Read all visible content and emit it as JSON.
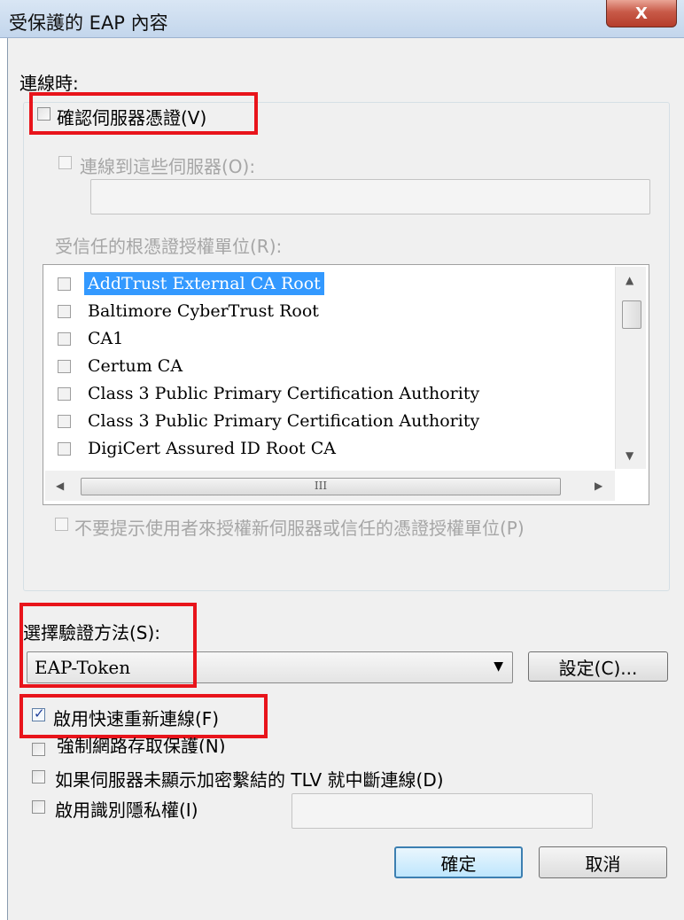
{
  "window": {
    "title": "受保護的 EAP 內容",
    "close_glyph": "X"
  },
  "connect": {
    "heading": "連線時:",
    "verify_cert": "確認伺服器憑證(V)",
    "connect_servers": "連線到這些伺服器(O):",
    "trusted_root_label": "受信任的根憑證授權單位(R):",
    "ca_list": [
      "AddTrust External CA Root",
      "Baltimore CyberTrust Root",
      "CA1",
      "Certum CA",
      "Class 3 Public Primary Certification Authority",
      "Class 3 Public Primary Certification Authority",
      "DigiCert Assured ID Root CA"
    ],
    "scroll_grip": "III",
    "no_prompt": "不要提示使用者來授權新伺服器或信任的憑證授權單位(P)"
  },
  "auth": {
    "method_label": "選擇驗證方法(S):",
    "method_value": "EAP-Token",
    "configure_button": "設定(C)...",
    "fast_reconnect": "啟用快速重新連線(F)",
    "enforce_nap": "強制網路存取保護(N)",
    "disconnect_tlv": "如果伺服器未顯示加密繫結的 TLV 就中斷連線(D)",
    "identity_privacy": "啟用識別隱私權(I)"
  },
  "buttons": {
    "ok": "確定",
    "cancel": "取消"
  },
  "colors": {
    "highlight": "#e8141b",
    "selection": "#3399ff"
  }
}
